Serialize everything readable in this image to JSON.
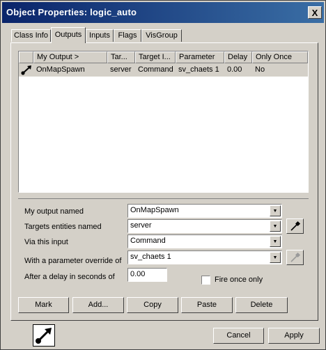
{
  "window": {
    "title": "Object Properties: logic_auto",
    "close_symbol": "X"
  },
  "tabs": [
    {
      "label": "Class Info"
    },
    {
      "label": "Outputs"
    },
    {
      "label": "Inputs"
    },
    {
      "label": "Flags"
    },
    {
      "label": "VisGroup"
    }
  ],
  "outputs_table": {
    "columns": [
      "My Output >",
      "Tar...",
      "Target I...",
      "Parameter",
      "Delay",
      "Only Once"
    ],
    "rows": [
      {
        "my_output": "OnMapSpawn",
        "target": "server",
        "target_input": "Command",
        "parameter": "sv_chaets 1",
        "delay": "0.00",
        "only_once": "No"
      }
    ]
  },
  "form": {
    "output_named_label": "My output named",
    "output_named_value": "OnMapSpawn",
    "targets_label": "Targets entities named",
    "targets_value": "server",
    "via_input_label": "Via this input",
    "via_input_value": "Command",
    "parameter_label": "With a parameter override of",
    "parameter_value": "sv_chaets 1",
    "delay_label": "After a delay in seconds of",
    "delay_value": "0.00",
    "fire_once_label": "Fire once only"
  },
  "action_buttons": {
    "mark": "Mark",
    "add": "Add...",
    "copy": "Copy",
    "paste": "Paste",
    "delete": "Delete"
  },
  "dialog_buttons": {
    "cancel": "Cancel",
    "apply": "Apply"
  },
  "icons": {
    "connection": "output-connection-icon",
    "eyedropper": "eyedropper-icon"
  }
}
